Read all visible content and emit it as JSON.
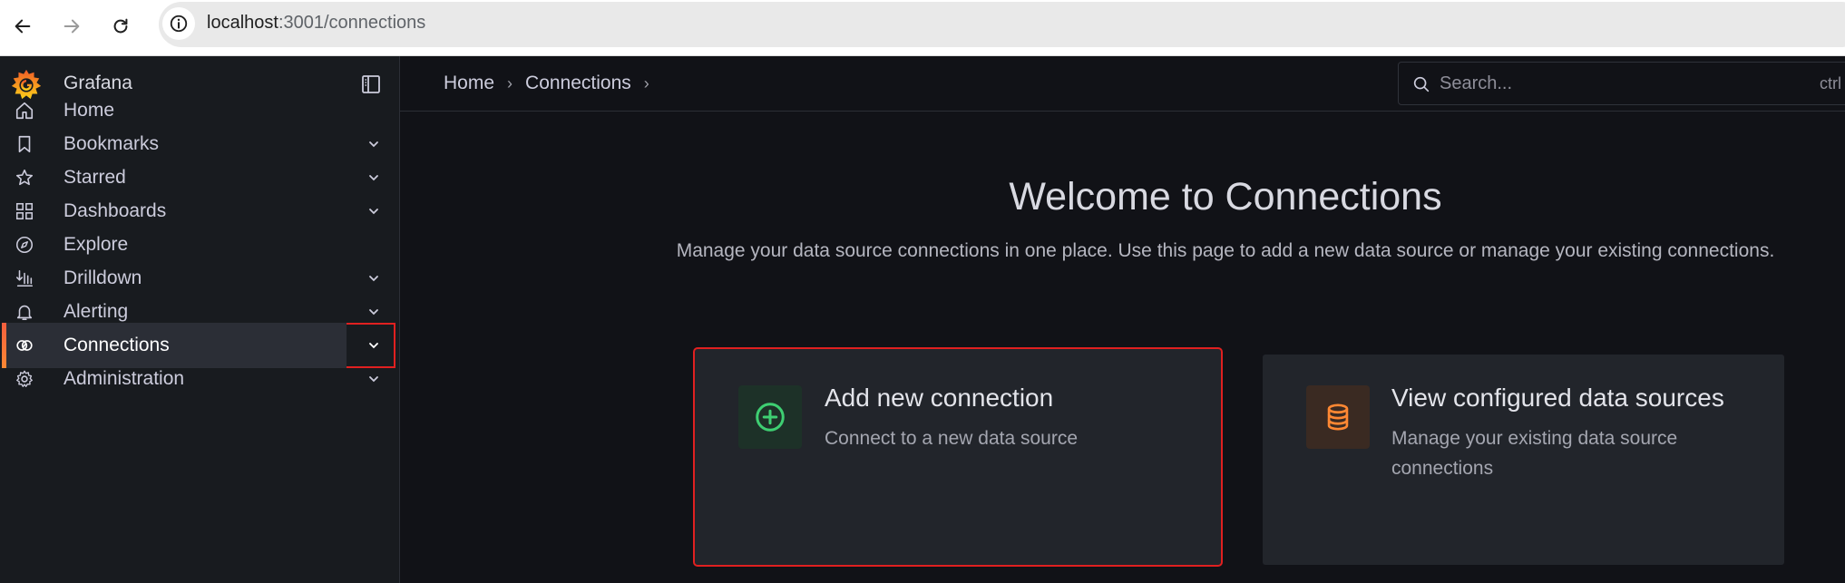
{
  "browser": {
    "url_host": "localhost",
    "url_path": ":3001/connections"
  },
  "sidebar": {
    "brand": "Grafana",
    "items": [
      {
        "label": "Home",
        "icon": "home-icon",
        "expandable": false
      },
      {
        "label": "Bookmarks",
        "icon": "bookmark-icon",
        "expandable": true
      },
      {
        "label": "Starred",
        "icon": "star-icon",
        "expandable": true
      },
      {
        "label": "Dashboards",
        "icon": "grid-icon",
        "expandable": true
      },
      {
        "label": "Explore",
        "icon": "compass-icon",
        "expandable": false
      },
      {
        "label": "Drilldown",
        "icon": "drilldown-icon",
        "expandable": true
      },
      {
        "label": "Alerting",
        "icon": "bell-icon",
        "expandable": true
      },
      {
        "label": "Connections",
        "icon": "connections-icon",
        "expandable": true,
        "active": true
      },
      {
        "label": "Administration",
        "icon": "cog-icon",
        "expandable": true
      }
    ]
  },
  "topbar": {
    "breadcrumb": [
      "Home",
      "Connections"
    ],
    "search_placeholder": "Search...",
    "search_shortcut": "ctrl"
  },
  "main": {
    "title": "Welcome to Connections",
    "subtitle": "Manage your data source connections in one place. Use this page to add a new data source or manage your existing connections.",
    "cards": [
      {
        "title": "Add new connection",
        "description": "Connect to a new data source",
        "icon": "plus-circle-icon",
        "accent": "#3ecf72"
      },
      {
        "title": "View configured data sources",
        "description": "Manage your existing data source connections",
        "icon": "database-icon",
        "accent": "#ff8833"
      }
    ]
  },
  "colors": {
    "background": "#111217",
    "sidebar": "#181b1f",
    "card": "#22252b",
    "highlight_outline": "#e02020",
    "active_bar": "#f55f3e"
  }
}
